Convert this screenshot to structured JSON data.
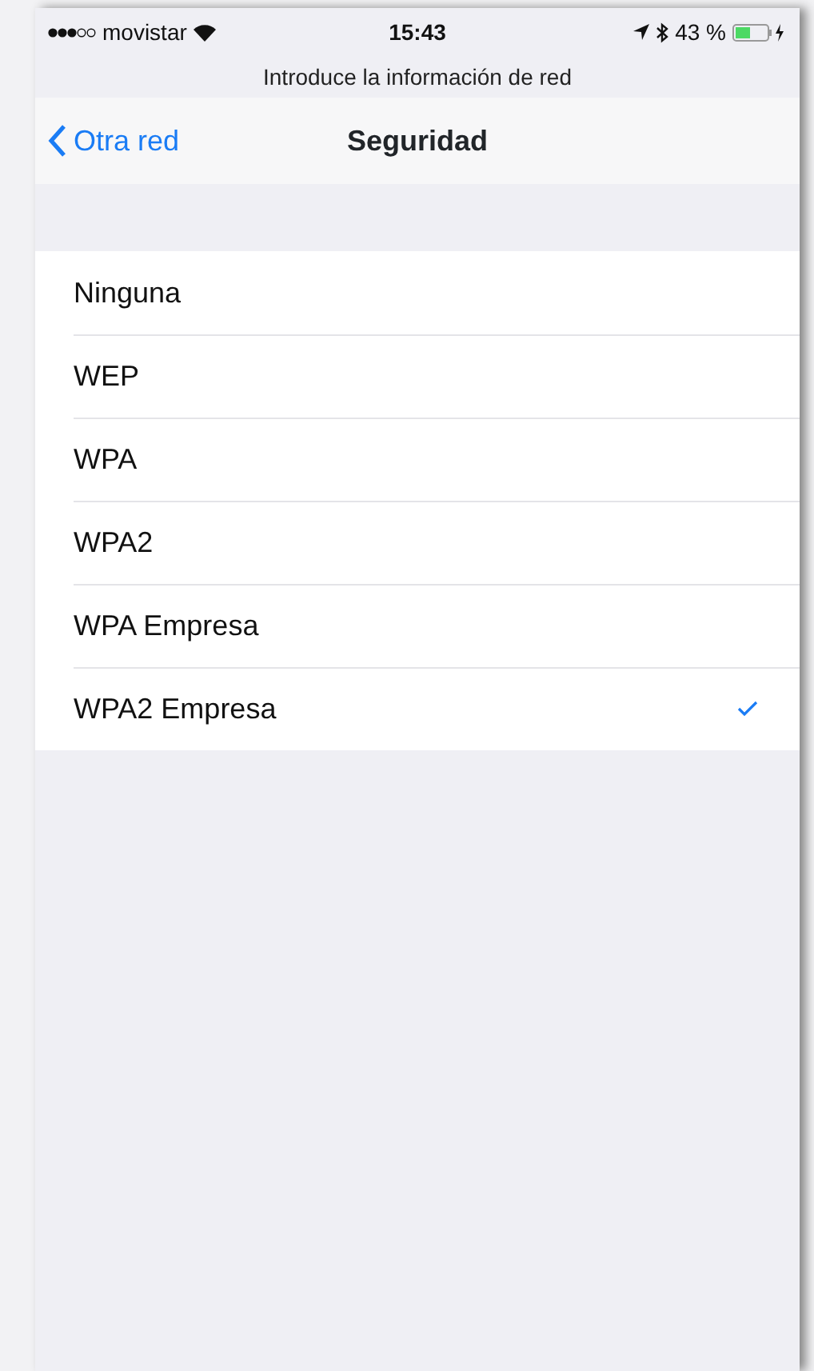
{
  "status_bar": {
    "carrier": "movistar",
    "time": "15:43",
    "battery": "43 %"
  },
  "prompt": "Introduce la información de red",
  "nav": {
    "back": "Otra red",
    "title": "Seguridad"
  },
  "options": [
    {
      "label": "Ninguna",
      "selected": false
    },
    {
      "label": "WEP",
      "selected": false
    },
    {
      "label": "WPA",
      "selected": false
    },
    {
      "label": "WPA2",
      "selected": false
    },
    {
      "label": "WPA Empresa",
      "selected": false
    },
    {
      "label": "WPA2 Empresa",
      "selected": true
    }
  ]
}
